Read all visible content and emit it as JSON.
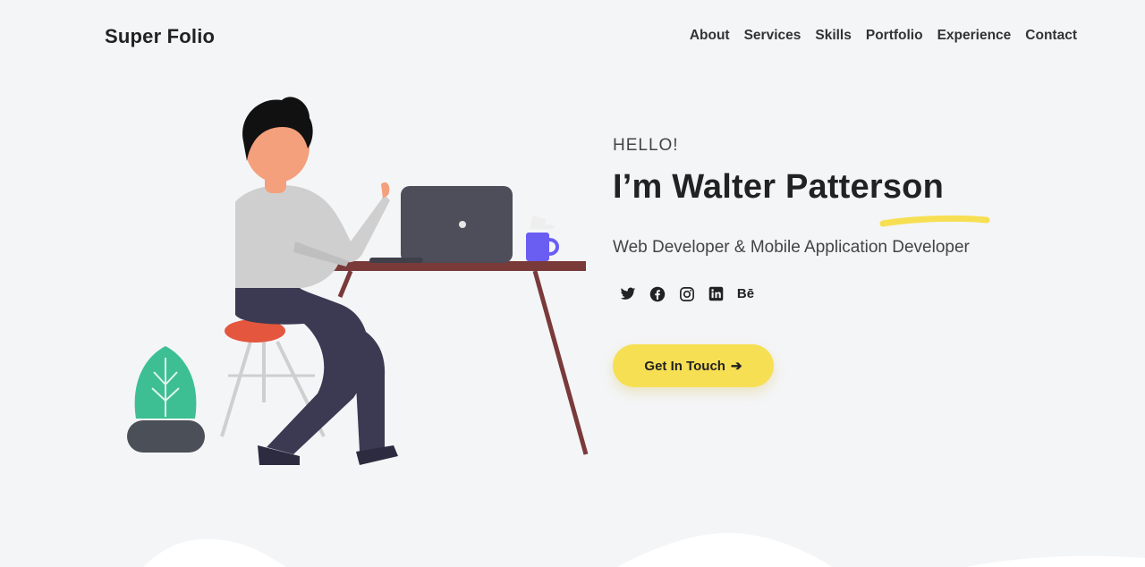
{
  "brand": "Super Folio",
  "nav": {
    "items": [
      "About",
      "Services",
      "Skills",
      "Portfolio",
      "Experience",
      "Contact"
    ]
  },
  "hero": {
    "greeting": "HELLO!",
    "name": "I’m Walter Patterson",
    "tagline": "Web Developer & Mobile Application Developer",
    "cta_label": "Get In Touch",
    "cta_arrow": "➔"
  },
  "socials": {
    "behance_label": "Bē",
    "items": [
      "twitter-icon",
      "facebook-icon",
      "instagram-icon",
      "linkedin-icon",
      "behance-icon"
    ]
  },
  "colors": {
    "background": "#f4f5f7",
    "accent_yellow": "#f7df54",
    "text_dark": "#222222",
    "desk": "#7a3a3a",
    "laptop": "#4d4e5a",
    "plant": "#3dbf93",
    "mug": "#6a5df2",
    "stool": "#e4563e"
  }
}
